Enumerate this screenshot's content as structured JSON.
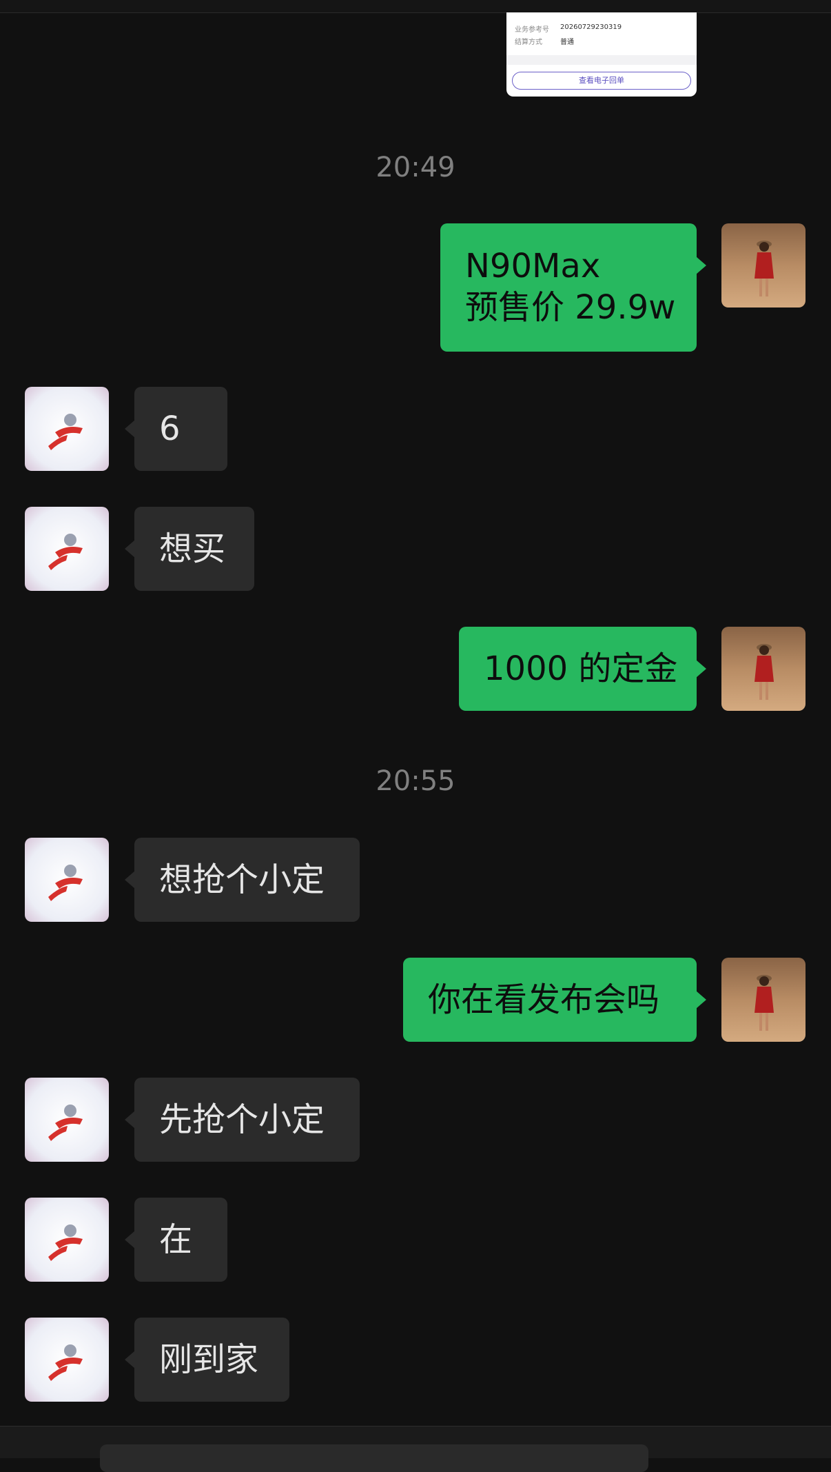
{
  "receipt": {
    "rows": [
      {
        "label": "业务参考号",
        "value": "20260729230319"
      },
      {
        "label": "结算方式",
        "value": "普通"
      }
    ],
    "button_label": "查看电子回单"
  },
  "timestamps": [
    "20:49",
    "20:55"
  ],
  "messages": [
    {
      "side": "out",
      "lines": [
        "N90Max",
        "预售价 29.9w"
      ]
    },
    {
      "side": "in",
      "text": "6"
    },
    {
      "side": "in",
      "text": "想买"
    },
    {
      "side": "out",
      "text": "1000 的定金"
    },
    {
      "side": "in",
      "text": "想抢个小定"
    },
    {
      "side": "out",
      "text": "你在看发布会吗"
    },
    {
      "side": "in",
      "text": "先抢个小定"
    },
    {
      "side": "in",
      "text": "在"
    },
    {
      "side": "in",
      "text": "刚到家"
    }
  ],
  "colors": {
    "background": "#111111",
    "outgoing_bubble": "#27b85f",
    "incoming_bubble": "#2b2b2b",
    "timestamp": "#808080"
  },
  "icons": {
    "self_avatar": "avatar-woman-in-red-desert",
    "contact_avatar": "avatar-cartoon-flying-character"
  }
}
